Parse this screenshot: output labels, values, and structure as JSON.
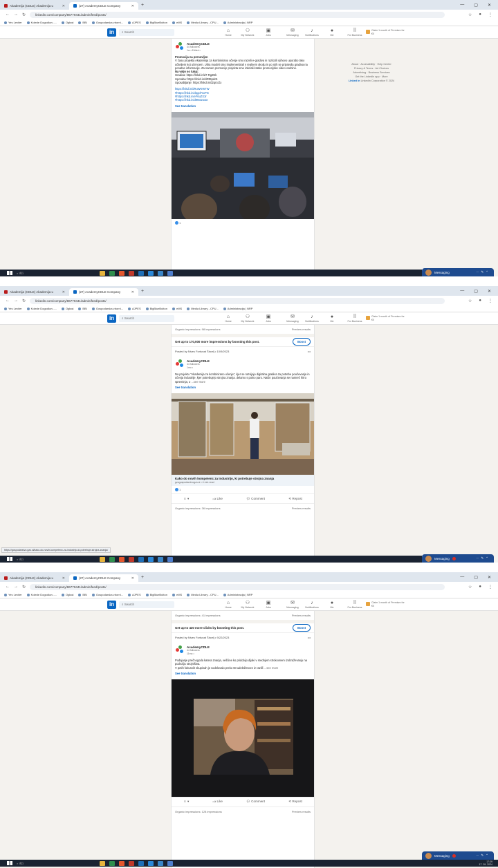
{
  "browser": {
    "tabs": [
      {
        "label": "Akademija (CDLE) Akademija u"
      },
      {
        "label": "(27) AcademyCDLE Company"
      }
    ],
    "url_1": "linkedin.com/company/86779441/admin/feed/posts/",
    "url_2": "linkedin.com/company/86779441/admin/feed/posts/",
    "bookmarks": [
      "Yes Leviter",
      "Kolede Dogodkov -...",
      "Oglasi",
      "BBI",
      "Gospodarska zborni...",
      "AJPES",
      "BigBlueButton",
      "eMS",
      "Media Library - CPU...",
      "Administracija | NRP"
    ]
  },
  "nav": {
    "search_placeholder": "Search",
    "items": [
      "Home",
      "My Network",
      "Jobs",
      "Messaging",
      "Notifications",
      "Me",
      "For Business"
    ],
    "premium": "Claim 1 month of Premium for €0"
  },
  "company": {
    "name": "AcademyCDLE",
    "followers": "44 followers"
  },
  "post1": {
    "meta": "1w • Edited •",
    "title": "Promocija na prenovljen",
    "body": "V času projekta Akademija za kombinirano učenje smo razvili e-gradiva in razlozili njihovo uporabo tako učiteljem kot učencem. Ultra modeli smo implementirali v realnem okolju in po njih se pripravila gradiva na ponatne informacije. Za namen promocije projekta smo izdelali kratke promocijske video vsebine.",
    "sub": "Na voljo so tukaj:",
    "lines": [
      "Gradiva: https://lnkd.in/d7-Rg2Nk",
      "Uporaba: https://lnkd.in/dZ39pdc5",
      "Uposabljanje: https://lnkd.in/d2qrcrZx"
    ],
    "links": [
      "https://lnkd.in/dRuWKWTW",
      "#https://lnkd.in/dpgd7sxPG",
      "#https://lnkd.in/eF6uZX3r",
      "#https://lnkd.in/d9Mz2ouD"
    ],
    "see_translation": "See translation",
    "reactions": "1"
  },
  "side": {
    "links": [
      "About",
      "Accessibility",
      "Help Center",
      "Privacy & Terms",
      "Ad Choices",
      "Advertising",
      "Business Services",
      "Get the LinkedIn app",
      "More"
    ],
    "copyright": "LinkedIn Corporation © 2024"
  },
  "post2": {
    "impressions_top": "Organic impressions: 98 impressions",
    "preview": "Preview results",
    "boost": "Get up to 170,000 more impressions by boosting this post.",
    "boost_btn": "Boost",
    "posted": "Posted by Nives Fortunat Šircelj • 10/9/2023",
    "meta": "1mo •",
    "body": "Na projektu \"Akademija za kombinirano učenje\", kjer se razvijajo digitalna gradiva za potrebe poučevanja in učenja industrije, kjer potrebujejo strojna znanja. delamo s polno paro. Način poučevanja se namreč hitro spreminja, o",
    "more": "...see more",
    "see_translation": "See translation",
    "article_title": "Kako do novih kompetenc za industrijo, ki potrebuje strojna znanja",
    "article_src": "gzsgospodarstvogzs.si • 4 min read",
    "reactions": "1",
    "actions": [
      "Like",
      "Comment",
      "Repost"
    ],
    "impressions": "Organic impressions: 36 impressions",
    "status_url": "https://gospodarstvo.gzs.si/kako-do-novih-kompetenc-za-industrijo-ki-potrebuje-strojna-znanja/"
  },
  "post3": {
    "impressions_top": "Organic impressions: 41 impressions",
    "preview": "Preview results",
    "boost": "Get up to 430 more clicks by boosting this post.",
    "boost_btn": "Boost",
    "posted": "Posted by Nives Fortunat Šircelj • 9/22/2023",
    "meta": "11mo •",
    "body1": "Podajanje prečnogoda katera znanja, veščine ko pridobijo dijaki v srednjem strokovnem izobraževanju na področju strojništva.",
    "body2": "V petih fokusnih skupinah je sodelovalo preko 60 udeležencev iz različ",
    "more": "...see more",
    "see_translation": "See translation",
    "actions": [
      "Like",
      "Comment",
      "Repost"
    ],
    "impressions": "Organic impressions: 128 impressions"
  },
  "messaging": {
    "label": "Messaging"
  },
  "taskbar": {
    "search": "Išči",
    "time1": "11:08",
    "date1": "17. 05. 2024",
    "time2": "17:29",
    "date2": "17. 05. 2024"
  }
}
